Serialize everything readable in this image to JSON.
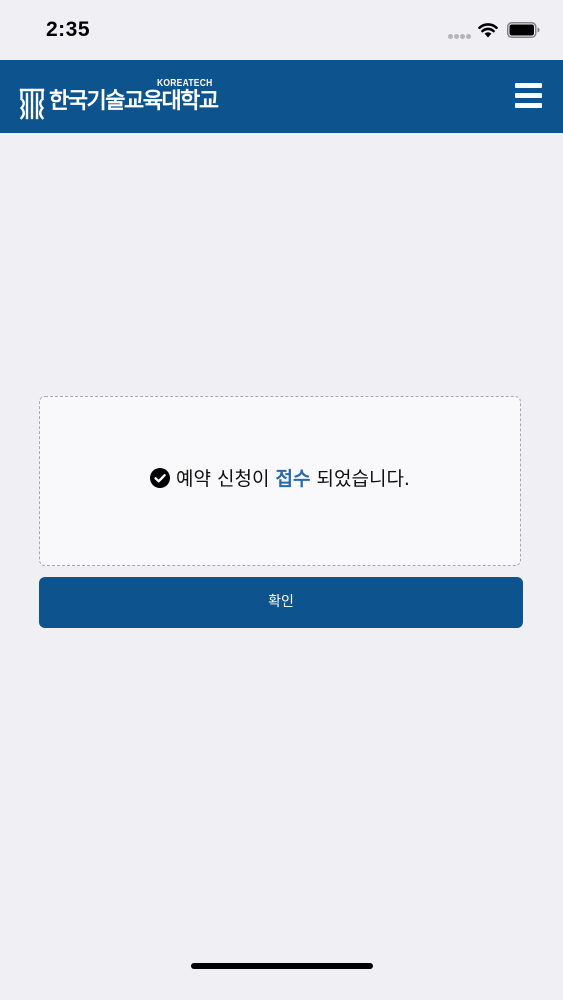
{
  "status_bar": {
    "time": "2:35"
  },
  "header": {
    "logo_korean": "한국기술교육대학교",
    "logo_english": "KOREATECH",
    "menu_icon": "hamburger-menu-icon",
    "background_color": "#0d538e"
  },
  "notice": {
    "icon": "check-circle-icon",
    "message_before": "예약 신청이",
    "message_highlight": "접수",
    "message_after": "되었습니다.",
    "highlight_color": "#2a6aac"
  },
  "confirm_button": {
    "label": "확인",
    "color": "#0d538e"
  }
}
